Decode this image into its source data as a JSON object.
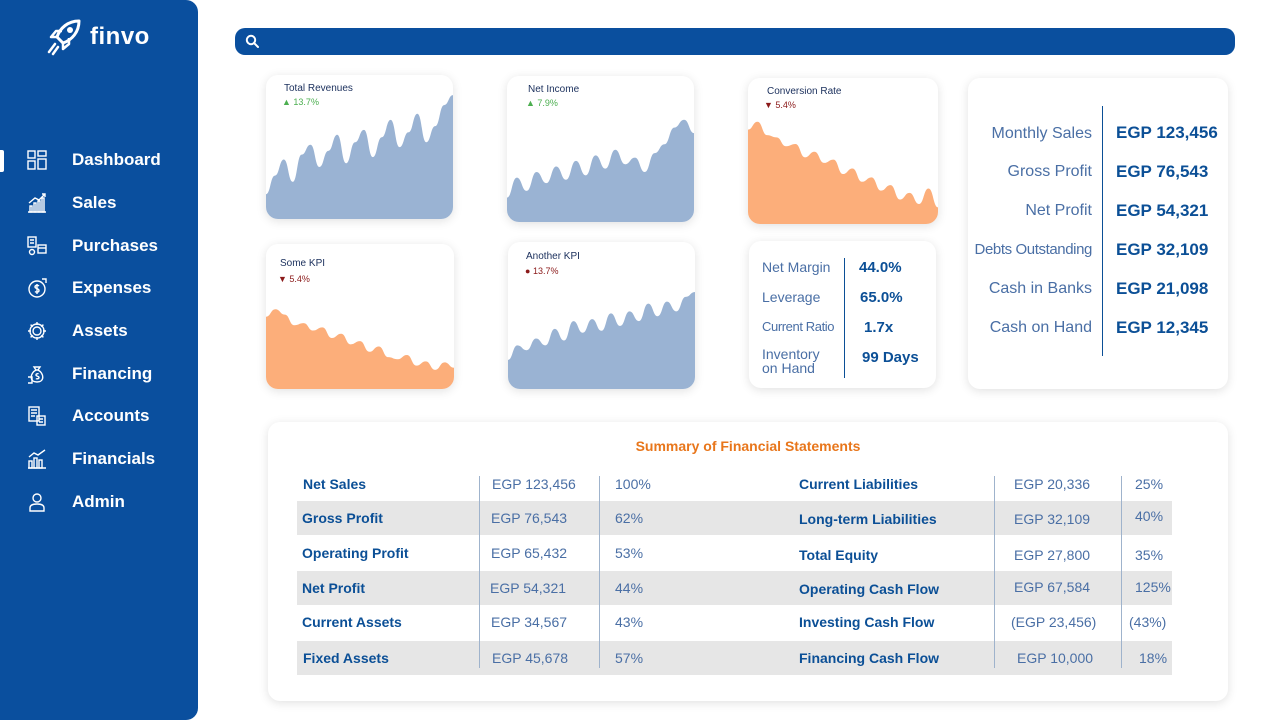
{
  "app": {
    "name": "finvo"
  },
  "search": {
    "placeholder": ""
  },
  "sidebar": {
    "items": [
      {
        "label": "Dashboard",
        "icon": "dashboard-icon"
      },
      {
        "label": "Sales",
        "icon": "sales-chart-icon"
      },
      {
        "label": "Purchases",
        "icon": "purchases-icon"
      },
      {
        "label": "Expenses",
        "icon": "expenses-coin-icon"
      },
      {
        "label": "Assets",
        "icon": "assets-gear-icon"
      },
      {
        "label": "Financing",
        "icon": "financing-money-bag-icon"
      },
      {
        "label": "Accounts",
        "icon": "accounts-ledger-icon"
      },
      {
        "label": "Financials",
        "icon": "financials-chart-icon"
      },
      {
        "label": "Admin",
        "icon": "admin-user-icon"
      }
    ]
  },
  "chart_data": [
    {
      "type": "area",
      "title": "Total Revenues",
      "change": "13.7%",
      "direction": "up",
      "values": [
        20,
        35,
        48,
        30,
        52,
        60,
        42,
        55,
        68,
        45,
        62,
        72,
        50,
        66,
        80,
        58,
        70,
        85,
        62,
        75,
        92,
        100
      ]
    },
    {
      "type": "area",
      "title": "Net Income",
      "change": "7.9%",
      "direction": "up",
      "values": [
        22,
        40,
        28,
        45,
        35,
        50,
        38,
        55,
        42,
        60,
        48,
        65,
        52,
        58,
        45,
        62,
        70,
        85,
        92,
        80
      ]
    },
    {
      "type": "area",
      "title": "Conversion Rate",
      "change": "5.4%",
      "direction": "down",
      "values": [
        85,
        92,
        80,
        78,
        70,
        72,
        60,
        65,
        55,
        58,
        45,
        50,
        38,
        42,
        30,
        35,
        22,
        28,
        18,
        32,
        15
      ]
    },
    {
      "type": "area",
      "title": "Some KPI",
      "change": "5.4%",
      "direction": "down",
      "values": [
        68,
        75,
        70,
        60,
        62,
        55,
        58,
        48,
        52,
        42,
        45,
        35,
        40,
        30,
        28,
        32,
        22,
        26,
        18,
        25,
        20
      ]
    },
    {
      "type": "area",
      "title": "Another KPI",
      "change": "13.7%",
      "direction": "neutral",
      "values": [
        30,
        45,
        40,
        52,
        45,
        62,
        50,
        70,
        58,
        72,
        60,
        78,
        65,
        80,
        70,
        88,
        75,
        90,
        80,
        95,
        100
      ]
    }
  ],
  "ratios": [
    {
      "label": "Net Margin",
      "value": "44.0%"
    },
    {
      "label": "Leverage",
      "value": "65.0%"
    },
    {
      "label": "Current Ratio",
      "value": "1.7x"
    },
    {
      "label": "Inventory on Hand",
      "value": "99 Days"
    }
  ],
  "kpis": [
    {
      "label": "Monthly Sales",
      "value": "EGP 123,456"
    },
    {
      "label": "Gross Profit",
      "value": "EGP 76,543"
    },
    {
      "label": "Net Profit",
      "value": "EGP 54,321"
    },
    {
      "label": "Debts Outstanding",
      "value": "EGP 32,109"
    },
    {
      "label": "Cash in Banks",
      "value": "EGP 21,098"
    },
    {
      "label": "Cash on Hand",
      "value": "EGP 12,345"
    }
  ],
  "summary": {
    "title": "Summary of Financial Statements",
    "rows": [
      {
        "left_label": "Net Sales",
        "left_value": "EGP 123,456",
        "left_pct": "100%",
        "right_label": "Current Liabilities",
        "right_value": "EGP 20,336",
        "right_pct": "25%"
      },
      {
        "left_label": "Gross Profit",
        "left_value": "EGP 76,543",
        "left_pct": "62%",
        "right_label": "Long-term Liabilities",
        "right_value": "EGP 32,109",
        "right_pct": "40%"
      },
      {
        "left_label": "Operating Profit",
        "left_value": "EGP 65,432",
        "left_pct": "53%",
        "right_label": "Total Equity",
        "right_value": "EGP 27,800",
        "right_pct": "35%"
      },
      {
        "left_label": "Net Profit",
        "left_value": "EGP 54,321",
        "left_pct": "44%",
        "right_label": "Operating Cash Flow",
        "right_value": "EGP 67,584",
        "right_pct": "125%"
      },
      {
        "left_label": "Current Assets",
        "left_value": "EGP 34,567",
        "left_pct": "43%",
        "right_label": "Investing Cash Flow",
        "right_value": "(EGP 23,456)",
        "right_pct": "(43%)"
      },
      {
        "left_label": "Fixed Assets",
        "left_value": "EGP 45,678",
        "left_pct": "57%",
        "right_label": "Financing Cash Flow",
        "right_value": "EGP 10,000",
        "right_pct": "18%"
      }
    ]
  },
  "colors": {
    "primary": "#0a4f9e",
    "area_blue": "#9ab3d3",
    "area_orange": "#fcae7a",
    "accent_orange": "#e8761b",
    "up": "#4caf50",
    "down": "#8b1a1a"
  }
}
